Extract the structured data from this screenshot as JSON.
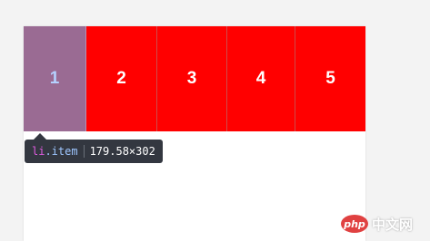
{
  "list": {
    "items": [
      {
        "label": "1"
      },
      {
        "label": "2"
      },
      {
        "label": "3"
      },
      {
        "label": "4"
      },
      {
        "label": "5"
      }
    ]
  },
  "tooltip": {
    "tag": "li",
    "class": ".item",
    "dimensions": "179.58×302"
  },
  "watermark": {
    "badge": "php",
    "text": "中文网"
  },
  "colors": {
    "item_bg": "#ff0000",
    "highlight_bg": "#9a6b93",
    "tooltip_bg": "#333740"
  }
}
